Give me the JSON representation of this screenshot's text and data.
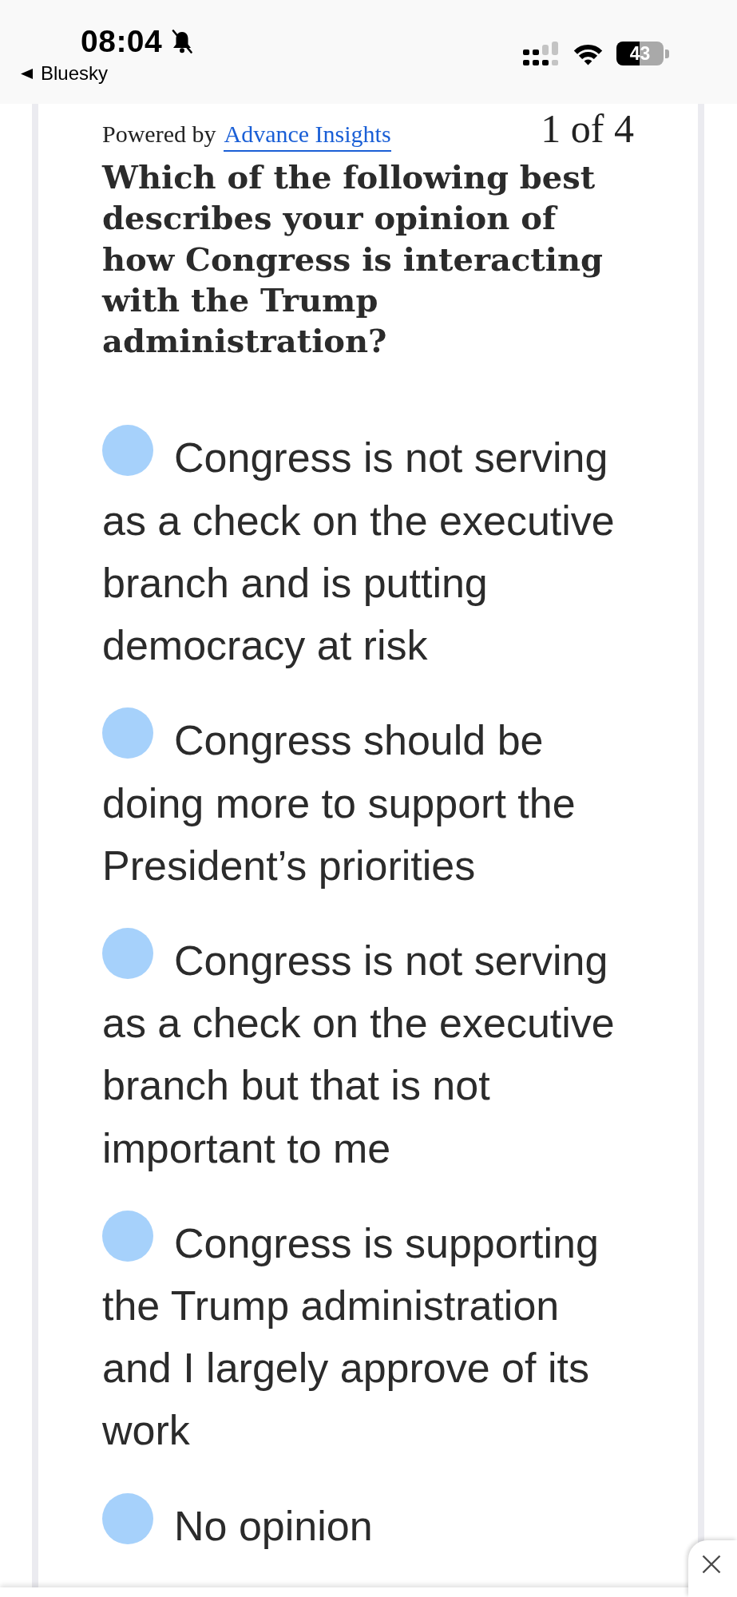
{
  "status_bar": {
    "time": "08:04",
    "back_label": "Bluesky",
    "battery": "43"
  },
  "poll": {
    "powered_by": "Powered by",
    "provider_link": "Advance Insights",
    "counter": "1 of 4",
    "question": "Which of the following best describes your opinion of how Congress is interacting with the Trump administration?",
    "options": [
      {
        "label": "Congress is not serving as a check on the executive branch and is putting democracy at risk",
        "selected": false
      },
      {
        "label": "Congress should be doing more to support the President’s priorities",
        "selected": false
      },
      {
        "label": "Congress is not serving as a check on the executive branch but that is not important to me",
        "selected": false
      },
      {
        "label": "Congress is supporting the Trump administration and I largely approve of its work",
        "selected": false
      },
      {
        "label": "No opinion",
        "selected": false
      }
    ]
  }
}
